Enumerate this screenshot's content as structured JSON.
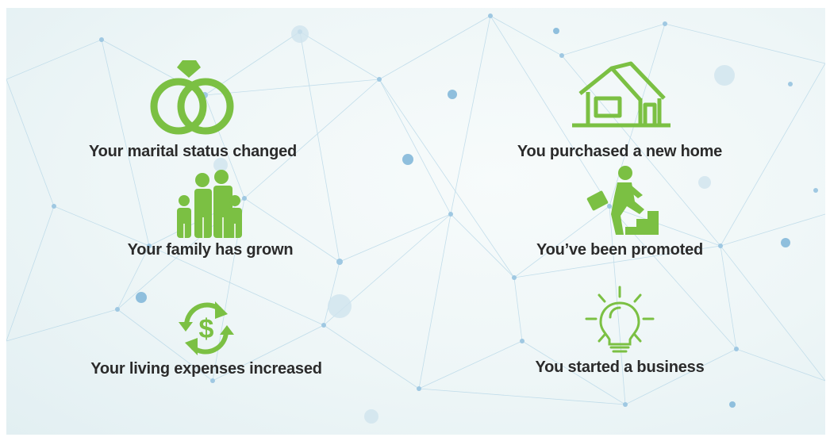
{
  "colors": {
    "accent": "#7bc043",
    "text": "#2b2b2b",
    "network": "#a9cfe4"
  },
  "life_events": {
    "marital": {
      "label": "Your marital status changed",
      "icon": "wedding-rings-icon"
    },
    "home": {
      "label": "You purchased a new home",
      "icon": "house-icon"
    },
    "family": {
      "label": "Your family has grown",
      "icon": "family-icon"
    },
    "promoted": {
      "label": "You’ve been promoted",
      "icon": "climbing-stairs-icon"
    },
    "expenses": {
      "label": "Your living expenses increased",
      "icon": "dollar-cycle-icon"
    },
    "business": {
      "label": "You started a business",
      "icon": "lightbulb-icon"
    }
  }
}
